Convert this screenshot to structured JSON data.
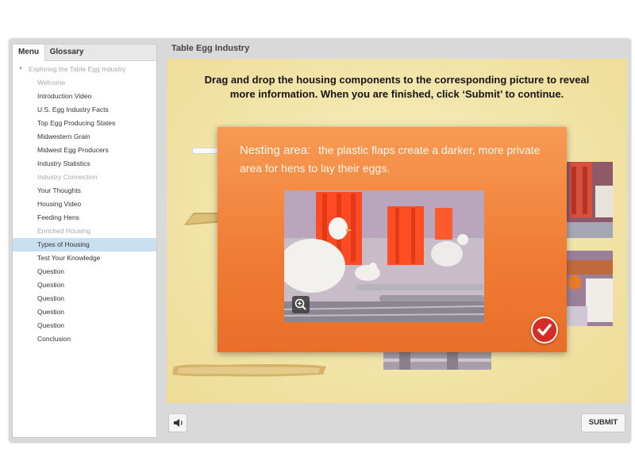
{
  "sidebar": {
    "tabs": {
      "menu": "Menu",
      "glossary": "Glossary"
    },
    "parent": "Exploring the Table Egg Industry",
    "items": [
      {
        "label": "Welcome",
        "dim": true
      },
      {
        "label": "Introduction Video"
      },
      {
        "label": "U.S. Egg Industry Facts"
      },
      {
        "label": "Top Egg Producing States"
      },
      {
        "label": "Midwestern Grain"
      },
      {
        "label": "Midwest Egg Producers"
      },
      {
        "label": "Industry Statistics"
      },
      {
        "label": "Industry Connection",
        "dim": true
      },
      {
        "label": "Your Thoughts"
      },
      {
        "label": "Housing Video"
      },
      {
        "label": "Feeding Hens"
      },
      {
        "label": "Enriched Housing",
        "dim": true
      },
      {
        "label": "Types of Housing",
        "active": true
      },
      {
        "label": "Test Your Knowledge"
      },
      {
        "label": "Question"
      },
      {
        "label": "Question"
      },
      {
        "label": "Question"
      },
      {
        "label": "Question"
      },
      {
        "label": "Question"
      },
      {
        "label": "Conclusion"
      }
    ]
  },
  "header": {
    "title": "Table Egg Industry"
  },
  "stage": {
    "instruction": "Drag and drop the housing components to the corresponding picture to reveal more information. When you are finished, click ‘Submit’ to continue."
  },
  "popup": {
    "term": "Nesting area:",
    "description": "the plastic flaps create a darker, more private area for hens to lay their eggs.",
    "accent_color": "#ef7b34"
  },
  "controls": {
    "submit_label": "SUBMIT"
  },
  "icons": {
    "zoom": "zoom-in-icon",
    "check": "checkmark-icon",
    "audio": "speaker-icon",
    "caret": "caret-down-icon"
  }
}
